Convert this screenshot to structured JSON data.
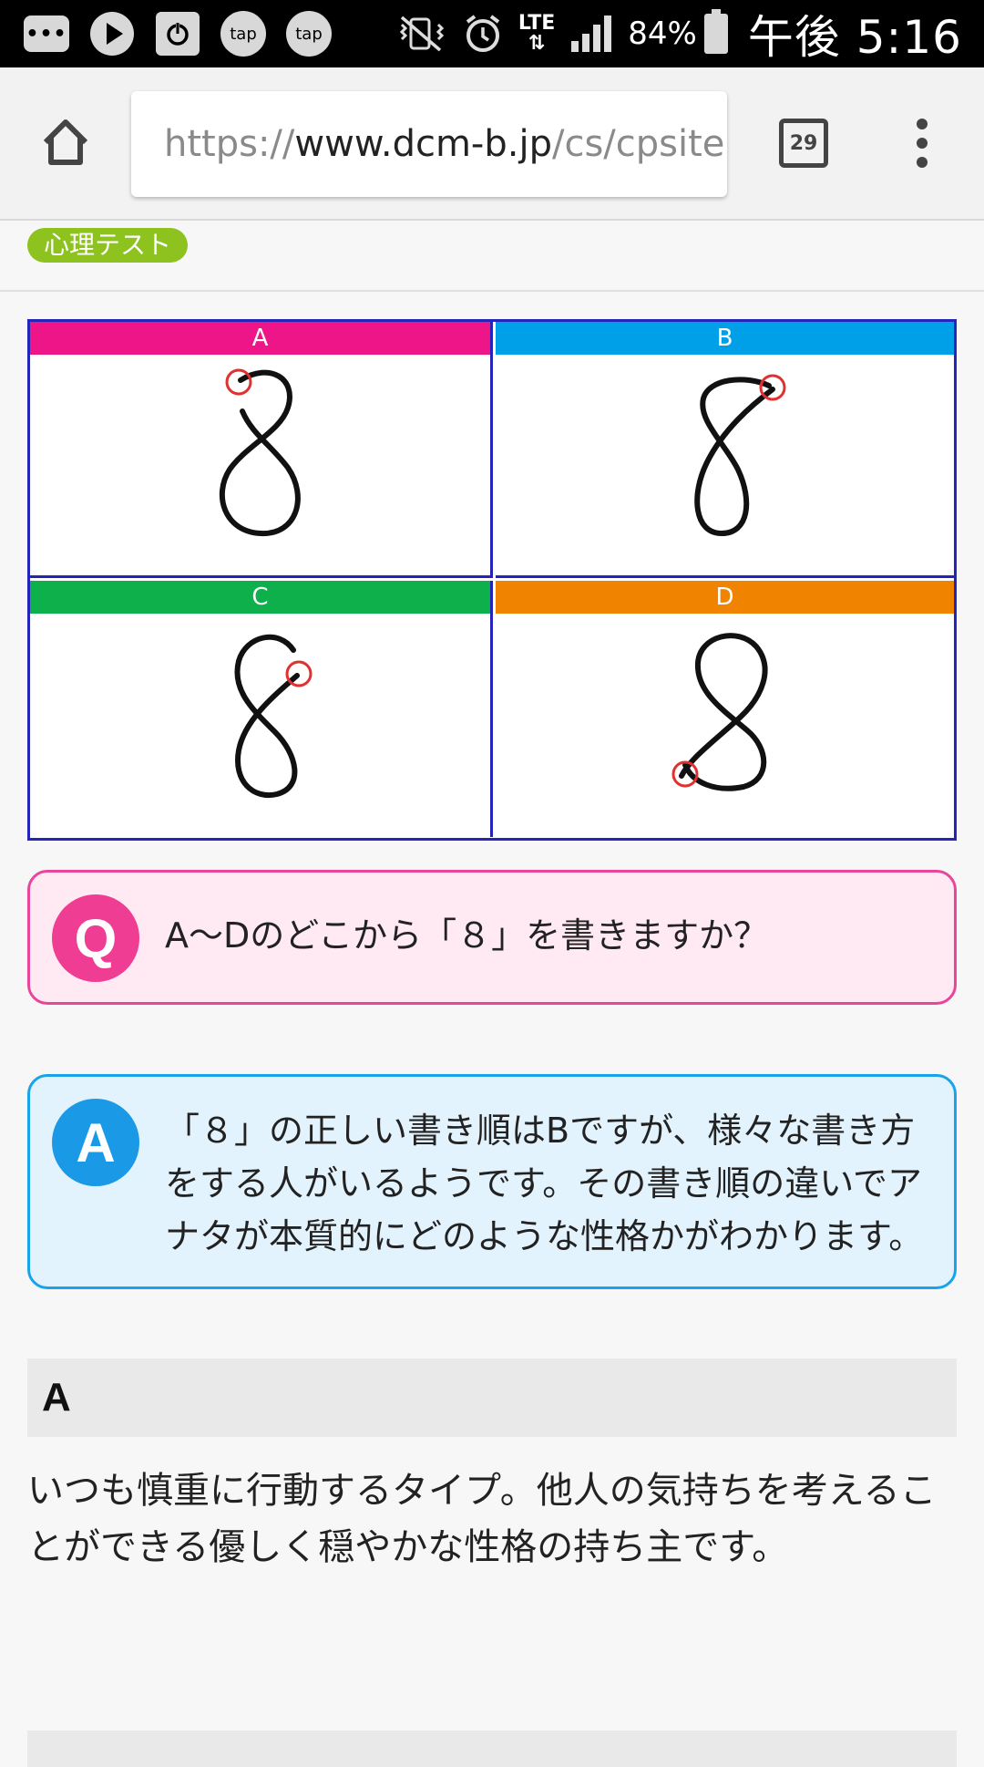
{
  "status_bar": {
    "tap_label_1": "tap",
    "tap_label_2": "tap",
    "network": "LTE",
    "battery": "84%",
    "time": "午後 5:16"
  },
  "browser": {
    "url_scheme": "https://",
    "url_host": "www.dcm-b.jp",
    "url_path": "/cs/cpsite.",
    "tab_count": "29"
  },
  "category_tag": "心理テスト",
  "grid": {
    "border_color": "#2424b8",
    "cells": [
      {
        "label": "A",
        "color": "#ed1588"
      },
      {
        "label": "B",
        "color": "#00a0e9"
      },
      {
        "label": "C",
        "color": "#0db04b"
      },
      {
        "label": "D",
        "color": "#f08300"
      }
    ]
  },
  "question": {
    "badge": "Q",
    "text": "A〜Dのどこから「８」を書きますか？",
    "accent": "#ee3d92"
  },
  "answer": {
    "badge": "A",
    "text": "「８」の正しい書き順はBですが、様々な書き方をする人がいるようです。その書き順の違いでアナタが本質的にどのような性格かがわかります。",
    "accent": "#1a9ae6"
  },
  "result_a": {
    "heading": "A",
    "body": "いつも慎重に行動するタイプ。他人の気持ちを考えることができる優しく穏やかな性格の持ち主です。"
  }
}
